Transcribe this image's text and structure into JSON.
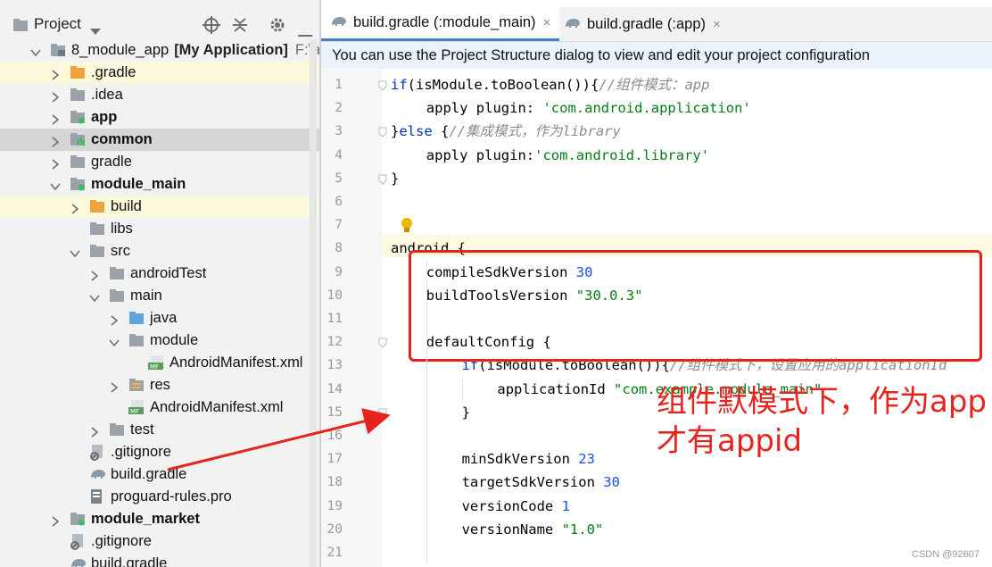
{
  "panel": {
    "title": "Project"
  },
  "tree": [
    {
      "label": "8_module_app",
      "suffix_bold": "[My Application]",
      "suffix": "F:\\andro",
      "bold": false,
      "icon": "module-icon",
      "arrow": "down",
      "indent": 0
    },
    {
      "label": ".gradle",
      "bold": false,
      "icon": "folder-orange-icon",
      "arrow": "right",
      "indent": 1,
      "bg": "yellow"
    },
    {
      "label": ".idea",
      "bold": false,
      "icon": "folder-grey-icon",
      "arrow": "right",
      "indent": 1
    },
    {
      "label": "app",
      "bold": true,
      "icon": "app-module-icon",
      "arrow": "right",
      "indent": 1
    },
    {
      "label": "common",
      "bold": true,
      "icon": "library-module-icon",
      "arrow": "right",
      "indent": 1,
      "bg": "grey"
    },
    {
      "label": "gradle",
      "bold": false,
      "icon": "folder-grey-icon",
      "arrow": "right",
      "indent": 1
    },
    {
      "label": "module_main",
      "bold": true,
      "icon": "app-module-icon",
      "arrow": "down",
      "indent": 1
    },
    {
      "label": "build",
      "bold": false,
      "icon": "folder-orange-icon",
      "arrow": "right",
      "indent": 2,
      "bg": "yellow"
    },
    {
      "label": "libs",
      "bold": false,
      "icon": "folder-grey-icon",
      "arrow": "",
      "indent": 2
    },
    {
      "label": "src",
      "bold": false,
      "icon": "folder-grey-icon",
      "arrow": "down",
      "indent": 2
    },
    {
      "label": "androidTest",
      "bold": false,
      "icon": "folder-grey-icon",
      "arrow": "right",
      "indent": 3
    },
    {
      "label": "main",
      "bold": false,
      "icon": "folder-grey-icon",
      "arrow": "down",
      "indent": 3
    },
    {
      "label": "java",
      "bold": false,
      "icon": "folder-blue-icon",
      "arrow": "right",
      "indent": 4
    },
    {
      "label": "module",
      "bold": false,
      "icon": "folder-grey-icon",
      "arrow": "down",
      "indent": 4
    },
    {
      "label": "AndroidManifest.xml",
      "bold": false,
      "icon": "manifest-icon",
      "arrow": "",
      "indent": 5
    },
    {
      "label": "res",
      "bold": false,
      "icon": "res-folder-icon",
      "arrow": "right",
      "indent": 4
    },
    {
      "label": "AndroidManifest.xml",
      "bold": false,
      "icon": "manifest-icon",
      "arrow": "",
      "indent": 4
    },
    {
      "label": "test",
      "bold": false,
      "icon": "folder-grey-icon",
      "arrow": "right",
      "indent": 3
    },
    {
      "label": ".gitignore",
      "bold": false,
      "icon": "gitignore-icon",
      "arrow": "",
      "indent": 2
    },
    {
      "label": "build.gradle",
      "bold": false,
      "icon": "gradle-icon",
      "arrow": "",
      "indent": 2
    },
    {
      "label": "proguard-rules.pro",
      "bold": false,
      "icon": "file-icon",
      "arrow": "",
      "indent": 2
    },
    {
      "label": "module_market",
      "bold": true,
      "icon": "app-module-icon",
      "arrow": "right",
      "indent": 1
    },
    {
      "label": ".gitignore",
      "bold": false,
      "icon": "gitignore-icon",
      "arrow": "",
      "indent": 1
    },
    {
      "label": "build.gradle",
      "bold": false,
      "icon": "gradle-icon",
      "arrow": "",
      "indent": 1
    }
  ],
  "tabs": [
    {
      "label": "build.gradle (:module_main)",
      "close": "×",
      "active": true
    },
    {
      "label": "build.gradle (:app)",
      "close": "×",
      "active": false
    }
  ],
  "notice": "You can use the Project Structure dialog to view and edit your project configuration",
  "code": [
    {
      "n": "1",
      "indent": 0,
      "parts": [
        [
          "kw",
          "if"
        ],
        [
          "",
          "(isModule.toBoolean()){"
        ],
        [
          "cmt",
          "//组件模式：app"
        ]
      ]
    },
    {
      "n": "2",
      "indent": 1,
      "parts": [
        [
          "",
          "apply plugin: "
        ],
        [
          "str",
          "'com.android.application'"
        ]
      ]
    },
    {
      "n": "3",
      "indent": 0,
      "parts": [
        [
          "",
          "}"
        ],
        [
          "kw",
          "else"
        ],
        [
          "",
          " {"
        ],
        [
          "cmt",
          "//集成模式，作为library"
        ]
      ]
    },
    {
      "n": "4",
      "indent": 1,
      "parts": [
        [
          "",
          "apply plugin:"
        ],
        [
          "str",
          "'com.android.library'"
        ]
      ]
    },
    {
      "n": "5",
      "indent": 0,
      "parts": [
        [
          "",
          "}"
        ]
      ]
    },
    {
      "n": "6",
      "indent": 0,
      "parts": []
    },
    {
      "n": "7",
      "indent": 0,
      "parts": []
    },
    {
      "n": "8",
      "indent": 0,
      "parts": [
        [
          "",
          "android {"
        ]
      ]
    },
    {
      "n": "9",
      "indent": 1,
      "parts": [
        [
          "",
          "compileSdkVersion "
        ],
        [
          "num",
          "30"
        ]
      ]
    },
    {
      "n": "10",
      "indent": 1,
      "parts": [
        [
          "",
          "buildToolsVersion "
        ],
        [
          "str",
          "\"30.0.3\""
        ]
      ]
    },
    {
      "n": "11",
      "indent": 0,
      "parts": []
    },
    {
      "n": "12",
      "indent": 1,
      "parts": [
        [
          "",
          "defaultConfig {"
        ]
      ]
    },
    {
      "n": "13",
      "indent": 2,
      "parts": [
        [
          "kw",
          "if"
        ],
        [
          "",
          "(isModule.toBoolean()){"
        ],
        [
          "cmt",
          "//组件模式下，设置应用的applicationId"
        ]
      ]
    },
    {
      "n": "14",
      "indent": 3,
      "parts": [
        [
          "",
          "applicationId "
        ],
        [
          "str",
          "\"com.example.module_main\""
        ]
      ]
    },
    {
      "n": "15",
      "indent": 2,
      "parts": [
        [
          "",
          "}"
        ]
      ]
    },
    {
      "n": "16",
      "indent": 0,
      "parts": []
    },
    {
      "n": "17",
      "indent": 2,
      "parts": [
        [
          "",
          "minSdkVersion "
        ],
        [
          "num",
          "23"
        ]
      ]
    },
    {
      "n": "18",
      "indent": 2,
      "parts": [
        [
          "",
          "targetSdkVersion "
        ],
        [
          "num",
          "30"
        ]
      ]
    },
    {
      "n": "19",
      "indent": 2,
      "parts": [
        [
          "",
          "versionCode "
        ],
        [
          "num",
          "1"
        ]
      ]
    },
    {
      "n": "20",
      "indent": 2,
      "parts": [
        [
          "",
          "versionName "
        ],
        [
          "str",
          "\"1.0\""
        ]
      ]
    },
    {
      "n": "21",
      "indent": 0,
      "parts": []
    }
  ],
  "annotation": {
    "line1": "组件默模式下，作为app",
    "line2": "才有appid"
  },
  "watermark": "CSDN @92607",
  "colors": {
    "accent": "#4083c9",
    "annotation": "#e8231e",
    "keyword": "#0033b3",
    "string": "#067d17",
    "number": "#1750eb",
    "comment": "#8c8c8c"
  }
}
